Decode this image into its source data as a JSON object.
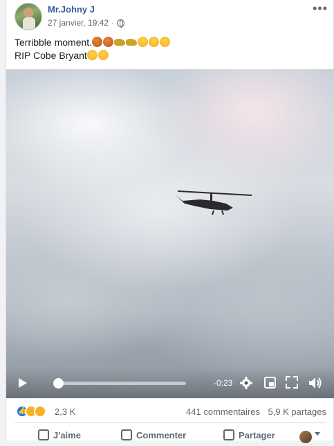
{
  "post": {
    "author": "Mr.Johny J",
    "date": "27 janvier, 19:42",
    "separator": "·",
    "more_label": "•••",
    "text_line1": "Terribble moment.",
    "text_line2": "RIP Cobe Bryant",
    "line1_emojis": [
      "basketball",
      "basketball",
      "helicopter",
      "helicopter",
      "crying-face",
      "crying-face",
      "crying-face"
    ],
    "line2_emojis": [
      "crying-face",
      "crying-face"
    ]
  },
  "video": {
    "time_remaining": "-0:23",
    "progress": 0.0
  },
  "stats": {
    "reactions": [
      "like",
      "sad",
      "wow"
    ],
    "reaction_count": "2,3 K",
    "comments": "441 commentaires",
    "shares": "5,9 K partages"
  },
  "actions": {
    "like": "J'aime",
    "comment": "Commenter",
    "share": "Partager"
  },
  "colors": {
    "author": "#385898",
    "like_blue": "#1877f2",
    "muted": "#606770"
  }
}
